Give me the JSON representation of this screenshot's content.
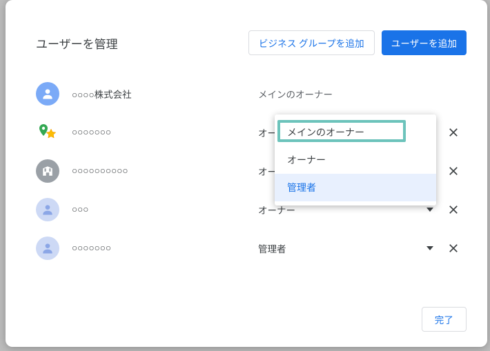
{
  "header": {
    "title": "ユーザーを管理",
    "add_group_label": "ビジネス グループを追加",
    "add_user_label": "ユーザーを追加"
  },
  "roles": {
    "primary_owner": "メインのオーナー",
    "owner": "オーナー",
    "manager": "管理者"
  },
  "users": [
    {
      "name": "○○○○株式会社",
      "role": "メインのオーナー",
      "editable": false,
      "removable": false,
      "avatar": "person-blue"
    },
    {
      "name": "○○○○○○○",
      "role": "オーナー",
      "editable": true,
      "removable": true,
      "avatar": "pin-star"
    },
    {
      "name": "○○○○○○○○○○",
      "role": "オーナー",
      "editable": true,
      "removable": true,
      "avatar": "building"
    },
    {
      "name": "○○○",
      "role": "オーナー",
      "editable": true,
      "removable": true,
      "avatar": "person-light"
    },
    {
      "name": "○○○○○○○",
      "role": "管理者",
      "editable": true,
      "removable": true,
      "avatar": "person-light"
    }
  ],
  "dropdown": {
    "options": [
      "メインのオーナー",
      "オーナー",
      "管理者"
    ],
    "hover_index": 2
  },
  "footer": {
    "done_label": "完了"
  }
}
